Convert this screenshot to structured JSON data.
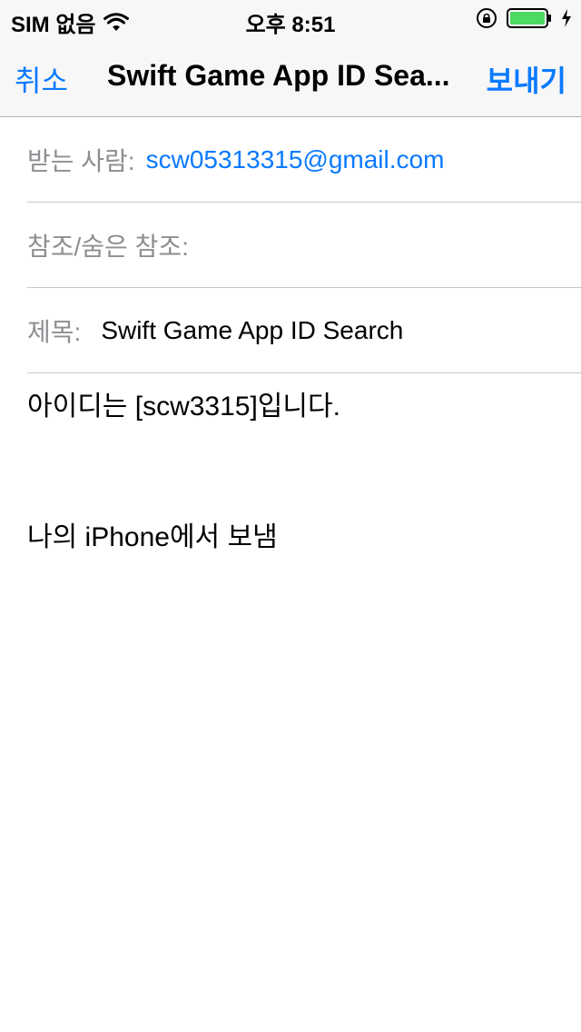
{
  "status": {
    "carrier": "SIM 없음",
    "time": "오후 8:51",
    "battery_color": "#4cd964"
  },
  "nav": {
    "cancel_label": "취소",
    "title": "Swift Game App ID Sea...",
    "send_label": "보내기"
  },
  "fields": {
    "to_label": "받는 사람:",
    "to_value": "scw05313315@gmail.com",
    "cc_label": "참조/숨은 참조:",
    "cc_value": "",
    "subject_label": "제목:",
    "subject_value": "Swift Game App ID Search"
  },
  "body": {
    "line1": "아이디는 [scw3315]입니다.",
    "signature": "나의 iPhone에서 보냄"
  },
  "colors": {
    "accent": "#0a7aff",
    "label_gray": "#8e8e93"
  }
}
